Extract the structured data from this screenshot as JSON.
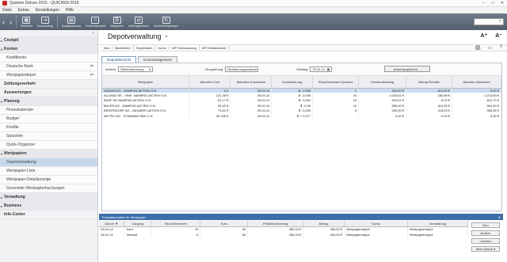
{
  "window": {
    "title": "Quicken Deluxe 2015 - QUICKEN 2015",
    "controls": [
      "–",
      "□",
      "✕"
    ]
  },
  "menu": [
    "Datei",
    "Extras",
    "Einstellungen",
    "Hilfe"
  ],
  "toolbar": {
    "buttons": [
      {
        "label": "Übersicht",
        "icon": "calendar-icon"
      },
      {
        "label": "Dauerauftrag",
        "icon": "arrow-icon"
      },
      {
        "label": "Budgetplanung",
        "icon": "chart-icon"
      },
      {
        "label": "Kontenübersicht",
        "icon": "bank-icon"
      },
      {
        "label": "Kategorien",
        "icon": "list-icon"
      },
      {
        "label": "Zahlungsverkehr",
        "icon": "transfer-icon"
      },
      {
        "label": "Senden/Empfangen",
        "icon": "sync-icon"
      }
    ],
    "search_icon": "search-icon"
  },
  "sidebar": {
    "items": [
      {
        "label": "Cockpit",
        "type": "header"
      },
      {
        "label": "Konten",
        "type": "header",
        "expanded": true
      },
      {
        "label": "Kreditkonto",
        "type": "sub"
      },
      {
        "label": "Deutsche Bank",
        "type": "sub",
        "mini": "⇄"
      },
      {
        "label": "Wertpapierdepot",
        "type": "sub",
        "mini": "⇄"
      },
      {
        "label": "Zahlungsverkehr",
        "type": "bold"
      },
      {
        "label": "Auswertungen",
        "type": "bold"
      },
      {
        "label": "Planung",
        "type": "header",
        "expanded": true
      },
      {
        "label": "Finanzkalender",
        "type": "sub"
      },
      {
        "label": "Budget",
        "type": "sub"
      },
      {
        "label": "Kredite",
        "type": "sub"
      },
      {
        "label": "Sparziele",
        "type": "sub"
      },
      {
        "label": "Quick-Organizer",
        "type": "sub"
      },
      {
        "label": "Wertpapiere",
        "type": "header",
        "expanded": true
      },
      {
        "label": "Depotverwaltung",
        "type": "sub",
        "active": true
      },
      {
        "label": "Wertpapier-Liste",
        "type": "sub"
      },
      {
        "label": "Wertpapier-Detailanzeige",
        "type": "sub"
      },
      {
        "label": "Gemeinde Wertpapierbuchungen",
        "type": "sub"
      },
      {
        "label": "Verwaltung",
        "type": "header"
      },
      {
        "label": "Business",
        "type": "header"
      },
      {
        "label": "Info-Center",
        "type": "bold"
      }
    ]
  },
  "page": {
    "title": "Depotverwaltung",
    "font_sizes": [
      "A⁺",
      "A⁻"
    ],
    "actions": [
      "Neu",
      "Bearbeiten",
      "Depotdaten",
      "Kurse",
      "WP Kontoauszug",
      "WP Detailansicht"
    ],
    "right_icons": [
      "🖨",
      "▭",
      "?"
    ],
    "tabs": [
      "Depotübersicht",
      "Kursmanagement"
    ],
    "filters": {
      "ansicht_label": "Ansicht",
      "ansicht_value": "Wertentwicklung",
      "gruppierung_label": "Gruppierung",
      "gruppierung_value": "Realisierungsstatus",
      "stichtag_label": "Stichtag",
      "stichtag_value": "25.04.14",
      "button": "Ansichtsoptionen ..."
    }
  },
  "holdings": {
    "columns": [
      "Wertpapier",
      "Aktueller Kurs",
      "Aktuelles Kursdatum",
      "Kursänderung",
      "Stück/Nennwert Quicken",
      "Einstandsbetrag",
      "Betrag Rendite",
      "Aktueller Marktwert"
    ],
    "rows": [
      {
        "name": "ADIDAS AG - NAMENS-AKTIEN O.N.",
        "kurs": "0,0",
        "datum": "25.04.14",
        "aenderung": "-0,996",
        "trend": "down",
        "stueck": "1",
        "einstand": "410,00 €",
        "rendite": "-410,00 €",
        "markt": "0,00 €",
        "selected": true
      },
      {
        "name": "ALLIANZ SE - VINK. NAMENS-AKTIEN O.N.",
        "kurs": "121,45 €",
        "datum": "25.04.14",
        "aenderung": "-0,005",
        "trend": "down",
        "stueck": "10",
        "einstand": "1.033,61 €",
        "rendite": "180,89 €",
        "markt": "1.214,50 €",
        "selected": false
      },
      {
        "name": "BASF SE NAMENS-AKTIEN O.N.",
        "kurs": "81,17 €",
        "datum": "25.04.14",
        "aenderung": "-0,002",
        "trend": "down",
        "stueck": "10",
        "einstand": "803,51 €",
        "rendite": "8,19 €",
        "markt": "811,70 €",
        "selected": false
      },
      {
        "name": "BAYER AG - NAMENS-AKTIEN O.N.",
        "kurs": "96,43 €",
        "datum": "25.04.14",
        "aenderung": "-0,00",
        "trend": "down",
        "stueck": "10",
        "einstand": "550,00 €",
        "rendite": "414,30 €",
        "markt": "964,30 €",
        "selected": false
      },
      {
        "name": "BEIERSDORF AG - INHABER-AKTIEN O.N.",
        "kurs": "73,61 €",
        "datum": "25.04.14",
        "aenderung": "-0,003",
        "trend": "down",
        "stueck": "5",
        "einstand": "250,00 €",
        "rendite": "118,05 €",
        "markt": "368,05 €",
        "selected": false
      },
      {
        "name": "METRO AG - STAMMAKTIEN O.N.",
        "kurs": "28,765 €",
        "datum": "25.04.14",
        "aenderung": "+ 0,377",
        "trend": "up",
        "stueck": "",
        "einstand": "0,00 €",
        "rendite": "0,00 €",
        "markt": "0,00 €",
        "selected": false
      }
    ]
  },
  "transactions": {
    "title": "Transaktionsliste für Wertpapier",
    "close": "✕",
    "columns": [
      "Datum ▼",
      "Vorgang",
      "Stück/Nennwert",
      "Kurs",
      "Preis/Bruttoertrag",
      "Betrag",
      "Konto",
      "Verwahrung"
    ],
    "rows": [
      {
        "datum": "25.04.14",
        "vorgang": "Kauf",
        "stueck": "10",
        "kurs": "45",
        "preis": "450,00 €",
        "betrag": "450,00 €",
        "konto": "Wertpapierdepot",
        "verwahrung": "Wertpapierdepot"
      },
      {
        "datum": "25.04.14",
        "vorgang": "Verkauf",
        "stueck": "5",
        "kurs": "50",
        "preis": "250,00 €",
        "betrag": "250,00 €",
        "konto": "Wertpapierdepot",
        "verwahrung": "Wertpapierdepot"
      }
    ],
    "buttons": [
      "Neu",
      "Ändern",
      "Löschen",
      "Mehr Aktion ▾"
    ]
  },
  "colors": {
    "accent": "#3e6ea8",
    "negative": "#c62828",
    "positive": "#2e7d32",
    "toolbar": "#5f6a79"
  }
}
